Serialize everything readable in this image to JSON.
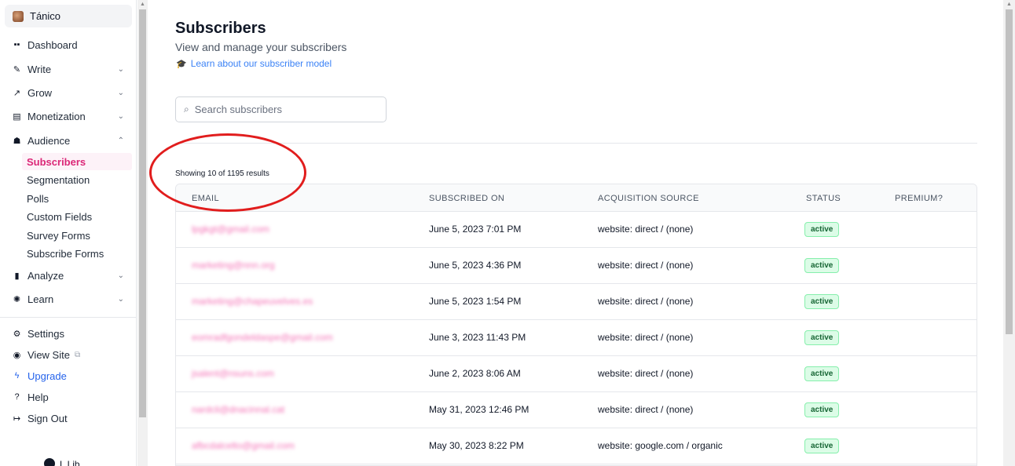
{
  "sidebar": {
    "brand": "Tánico",
    "items": [
      {
        "label": "Dashboard",
        "icon": "grid-icon",
        "glyph": "▪▪"
      },
      {
        "label": "Write",
        "icon": "pen-icon",
        "glyph": "✎"
      },
      {
        "label": "Grow",
        "icon": "trend-up-icon",
        "glyph": "↗"
      },
      {
        "label": "Monetization",
        "icon": "money-icon",
        "glyph": "▤"
      },
      {
        "label": "Audience",
        "icon": "users-icon",
        "glyph": "☗"
      },
      {
        "label": "Analyze",
        "icon": "bar-chart-icon",
        "glyph": "▮"
      },
      {
        "label": "Learn",
        "icon": "lightbulb-icon",
        "glyph": "✺"
      }
    ],
    "audience_subitems": [
      "Subscribers",
      "Segmentation",
      "Polls",
      "Custom Fields",
      "Survey Forms",
      "Subscribe Forms"
    ],
    "bottom_items": [
      {
        "label": "Settings",
        "icon": "gear-icon",
        "glyph": "⚙"
      },
      {
        "label": "View Site",
        "icon": "globe-icon",
        "glyph": "◉"
      },
      {
        "label": "Upgrade",
        "icon": "bolt-icon",
        "glyph": "ϟ"
      },
      {
        "label": "Help",
        "icon": "help-icon",
        "glyph": "?"
      },
      {
        "label": "Sign Out",
        "icon": "sign-out-icon",
        "glyph": "↦"
      }
    ],
    "footer_text": "L Lib..."
  },
  "main": {
    "title": "Subscribers",
    "subtitle": "View and manage your subscribers",
    "learn_link": "Learn about our subscriber model",
    "search_placeholder": "Search subscribers",
    "results_text": "Showing 10 of 1195 results",
    "table": {
      "headers": [
        "EMAIL",
        "SUBSCRIBED ON",
        "ACQUISITION SOURCE",
        "STATUS",
        "PREMIUM?"
      ],
      "rows": [
        {
          "email": "lpgkgt@gmail.com",
          "subscribed_on": "June 5, 2023 7:01 PM",
          "source": "website: direct / (none)",
          "status": "active"
        },
        {
          "email": "marketing@nnn.org",
          "subscribed_on": "June 5, 2023 4:36 PM",
          "source": "website: direct / (none)",
          "status": "active"
        },
        {
          "email": "marketing@chapeuvelves.es",
          "subscribed_on": "June 5, 2023 1:54 PM",
          "source": "website: direct / (none)",
          "status": "active"
        },
        {
          "email": "eomradfgondeldaspe@gmail.com",
          "subscribed_on": "June 3, 2023 11:43 PM",
          "source": "website: direct / (none)",
          "status": "active"
        },
        {
          "email": "jsalent@nsuns.com",
          "subscribed_on": "June 2, 2023 8:06 AM",
          "source": "website: direct / (none)",
          "status": "active"
        },
        {
          "email": "nardcli@dnacinnal.cat",
          "subscribed_on": "May 31, 2023 12:46 PM",
          "source": "website: direct / (none)",
          "status": "active"
        },
        {
          "email": "afbcdalcelto@gmail.com",
          "subscribed_on": "May 30, 2023 8:22 PM",
          "source": "website: google.com / organic",
          "status": "active"
        }
      ]
    }
  },
  "colors": {
    "accent_pink": "#db2777",
    "link_blue": "#3b82f6",
    "active_badge": "#dcfce7",
    "annotation_red": "#e11d1d"
  }
}
